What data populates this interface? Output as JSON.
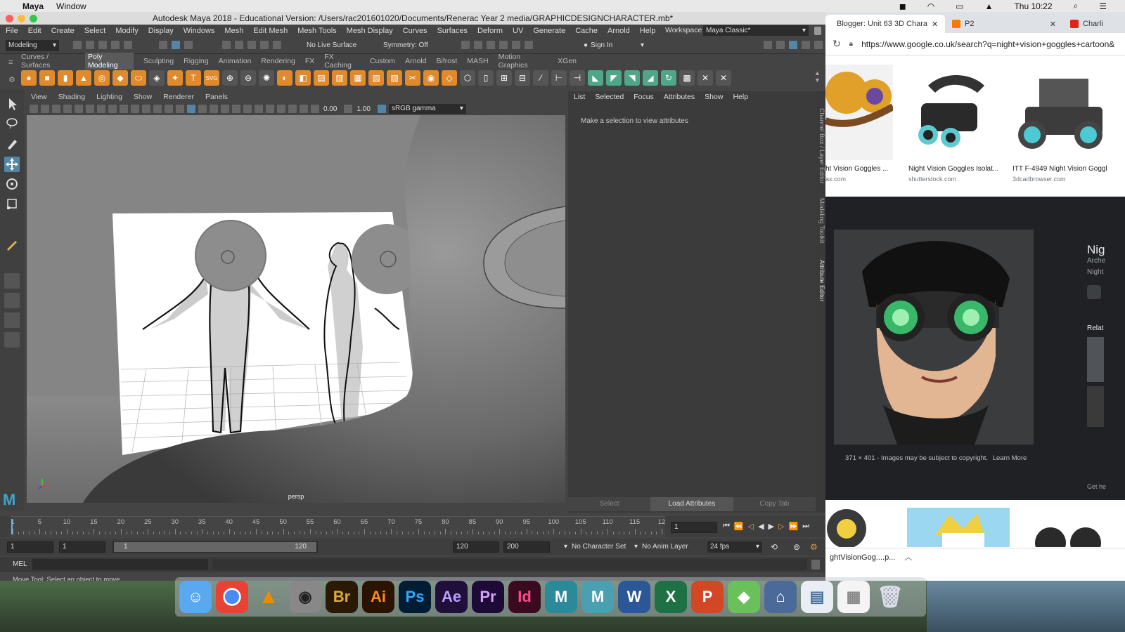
{
  "mac_menubar": {
    "apple": "",
    "app_name": "Maya",
    "menu_window": "Window",
    "clock": "Thu 10:22"
  },
  "maya": {
    "title": "Autodesk Maya 2018 - Educational Version: /Users/rac201601020/Documents/Renerac Year 2 media/GRAPHICDESIGNCHARACTER.mb*",
    "menus": [
      "File",
      "Edit",
      "Create",
      "Select",
      "Modify",
      "Display",
      "Windows",
      "Mesh",
      "Edit Mesh",
      "Mesh Tools",
      "Mesh Display",
      "Curves",
      "Surfaces",
      "Deform",
      "UV",
      "Generate",
      "Cache",
      "Arnold",
      "Help"
    ],
    "workspace_label": "Workspace :",
    "workspace_value": "Maya Classic*",
    "mode_select": "Modeling",
    "live_surface": "No Live Surface",
    "symmetry": "Symmetry: Off",
    "sign_in": "Sign In",
    "shelf_tabs": [
      "Curves / Surfaces",
      "Poly Modeling",
      "Sculpting",
      "Rigging",
      "Animation",
      "Rendering",
      "FX",
      "FX Caching",
      "Custom",
      "Arnold",
      "Bifrost",
      "MASH",
      "Motion Graphics",
      "XGen"
    ],
    "active_shelf": "Poly Modeling",
    "viewport_menus": [
      "View",
      "Shading",
      "Lighting",
      "Show",
      "Renderer",
      "Panels"
    ],
    "exposure": "0.00",
    "gamma": "1.00",
    "color_space": "sRGB gamma",
    "camera_label": "persp",
    "attr_menus": [
      "List",
      "Selected",
      "Focus",
      "Attributes",
      "Show",
      "Help"
    ],
    "attr_message": "Make a selection to view attributes",
    "attr_buttons": {
      "select": "Select",
      "load": "Load Attributes",
      "copy": "Copy Tab"
    },
    "side_tabs": [
      "Channel Box / Layer Editor",
      "Modeling Toolkit",
      "Attribute Editor"
    ],
    "timeline_ticks": [
      "1",
      "5",
      "10",
      "15",
      "20",
      "25",
      "30",
      "35",
      "40",
      "45",
      "50",
      "55",
      "60",
      "65",
      "70",
      "75",
      "80",
      "85",
      "90",
      "95",
      "100",
      "105",
      "110",
      "115",
      "12"
    ],
    "current_frame": "1",
    "range_start": "1",
    "range_inner_start": "1",
    "range_slider_start": "1",
    "range_slider_end": "120",
    "range_end": "120",
    "range_outer_end": "200",
    "character_set": "No Character Set",
    "anim_layer": "No Anim Layer",
    "fps": "24 fps",
    "cmd_label": "MEL",
    "help_line": "Move Tool: Select an object to move."
  },
  "browser": {
    "tabs": [
      "Blogger: Unit 63 3D Chara",
      "P2",
      "Charli"
    ],
    "url": "https://www.google.co.uk/search?q=night+vision+goggles+cartoon&",
    "results": [
      {
        "caption": "ht Vision Goggles ...",
        "source": "ax.com"
      },
      {
        "caption": "Night Vision Goggles Isolat...",
        "source": "shutterstock.com"
      },
      {
        "caption": "ITT F-4949 Night Vision Goggl",
        "source": "3dcadbrowser.com"
      }
    ],
    "image_meta": "371 × 401  -  Images may be subject to copyright.",
    "learn_more": "Learn More",
    "side_title": "Nig",
    "side_sub1": "Arche",
    "side_sub2": "Night",
    "related": "Relat",
    "get_help": "Get he",
    "download_file": "ghtVisionGog....p..."
  },
  "dock": {
    "apps": [
      "Finder",
      "Chrome",
      "VLC",
      "Screenshot",
      "Br",
      "Ai",
      "Ps",
      "Ae",
      "Pr",
      "Id",
      "MAYA",
      "MUD",
      "Word",
      "Excel",
      "PowerPoint",
      "Maps",
      "Apps",
      "Docs",
      "Grid",
      "Trash"
    ]
  },
  "colors": {
    "maya_bg": "#444444",
    "accent_blue": "#5285a6",
    "viewport_grey": "#808080",
    "dark_panel": "#202124"
  }
}
